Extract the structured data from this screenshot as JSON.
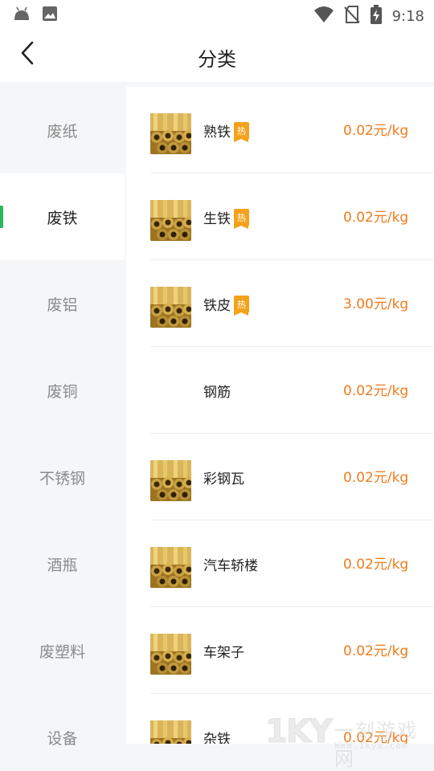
{
  "status_bar": {
    "time": "9:18",
    "left_icons": [
      "android-icon",
      "image-icon"
    ],
    "right_icons": [
      "wifi-icon",
      "no-sim-icon",
      "battery-charging-icon"
    ]
  },
  "nav": {
    "back_icon": "chevron-left-icon",
    "title": "分类"
  },
  "sidebar": {
    "active_index": 1,
    "items": [
      {
        "label": "废纸"
      },
      {
        "label": "废铁"
      },
      {
        "label": "废铝"
      },
      {
        "label": "废铜"
      },
      {
        "label": "不锈钢"
      },
      {
        "label": "酒瓶"
      },
      {
        "label": "废塑料"
      },
      {
        "label": "设备"
      }
    ]
  },
  "products": [
    {
      "name": "熟铁",
      "hot": true,
      "hot_label": "热",
      "price": "0.02元/kg",
      "has_image": true
    },
    {
      "name": "生铁",
      "hot": true,
      "hot_label": "热",
      "price": "0.02元/kg",
      "has_image": true
    },
    {
      "name": "铁皮",
      "hot": true,
      "hot_label": "热",
      "price": "3.00元/kg",
      "has_image": true
    },
    {
      "name": "钢筋",
      "hot": false,
      "price": "0.02元/kg",
      "has_image": false
    },
    {
      "name": "彩钢瓦",
      "hot": false,
      "price": "0.02元/kg",
      "has_image": true
    },
    {
      "name": "汽车轿楼",
      "hot": false,
      "price": "0.02元/kg",
      "has_image": true
    },
    {
      "name": "车架子",
      "hot": false,
      "price": "0.02元/kg",
      "has_image": true
    },
    {
      "name": "杂铁",
      "hot": false,
      "price": "0.02元/kg",
      "has_image": true
    }
  ],
  "colors": {
    "accent_green": "#2bb55e",
    "price_orange": "#f07b1c",
    "hot_badge": "#f4a21b",
    "sidebar_bg": "#f5f6f8"
  },
  "watermark": {
    "logo": "1KY",
    "text": "一刻游戏网",
    "url": "WWW.1kyx.com"
  }
}
